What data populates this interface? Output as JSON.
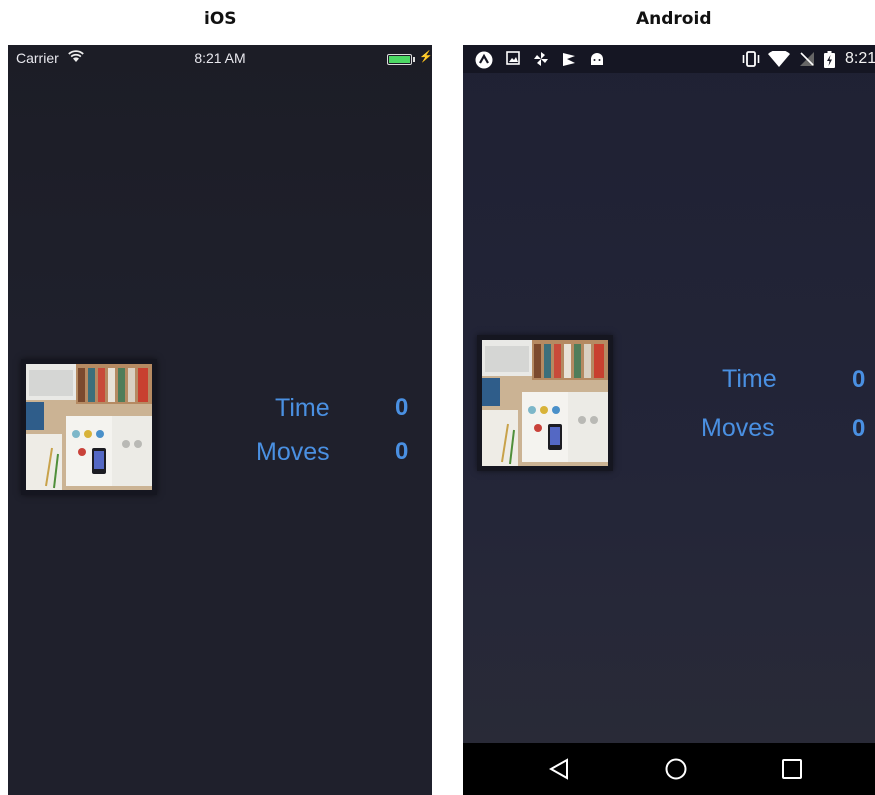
{
  "headings": {
    "ios": "iOS",
    "android": "Android"
  },
  "ios": {
    "status": {
      "carrier": "Carrier",
      "time": "8:21 AM",
      "battery_color": "#4cd964"
    },
    "stats": {
      "time_label": "Time",
      "time_value": "0",
      "moves_label": "Moves",
      "moves_value": "0"
    }
  },
  "android": {
    "status": {
      "time": "8:21"
    },
    "stats": {
      "time_label": "Time",
      "time_value": "0",
      "moves_label": "Moves",
      "moves_value": "0"
    },
    "nav": [
      "back",
      "home",
      "recents"
    ]
  },
  "colors": {
    "accent": "#4a90e2",
    "background": "#1f202c"
  },
  "puzzle_image": "desk-flatlay-photo"
}
